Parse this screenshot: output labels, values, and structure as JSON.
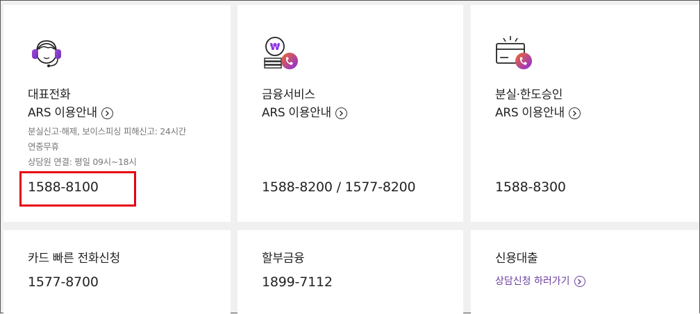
{
  "cards": [
    {
      "title": "대표전화",
      "ars": "ARS 이용안내",
      "desc1": "분실신고·해제, 보이스피싱 피해신고: 24시간",
      "desc2": "연중무휴",
      "desc3": "상담원 연결: 평일 09시~18시",
      "phone": "1588-8100",
      "icon": "headset-icon"
    },
    {
      "title": "금융서비스",
      "ars": "ARS 이용안내",
      "phone": "1588-8200 / 1577-8200",
      "icon": "won-coin-phone-icon"
    },
    {
      "title": "분실·한도승인",
      "ars": "ARS 이용안내",
      "phone": "1588-8300",
      "icon": "card-phone-icon"
    },
    {
      "title": "카드 빠른 전화신청",
      "phone": "1577-8700"
    },
    {
      "title": "할부금융",
      "phone": "1899-7112"
    },
    {
      "title": "신용대출",
      "link": "상담신청 하러가기"
    }
  ],
  "colors": {
    "accent": "#6a3c9e",
    "highlight": "#e60012",
    "icon_gradient_start": "#f06a2c",
    "icon_gradient_end": "#8a2be2"
  }
}
